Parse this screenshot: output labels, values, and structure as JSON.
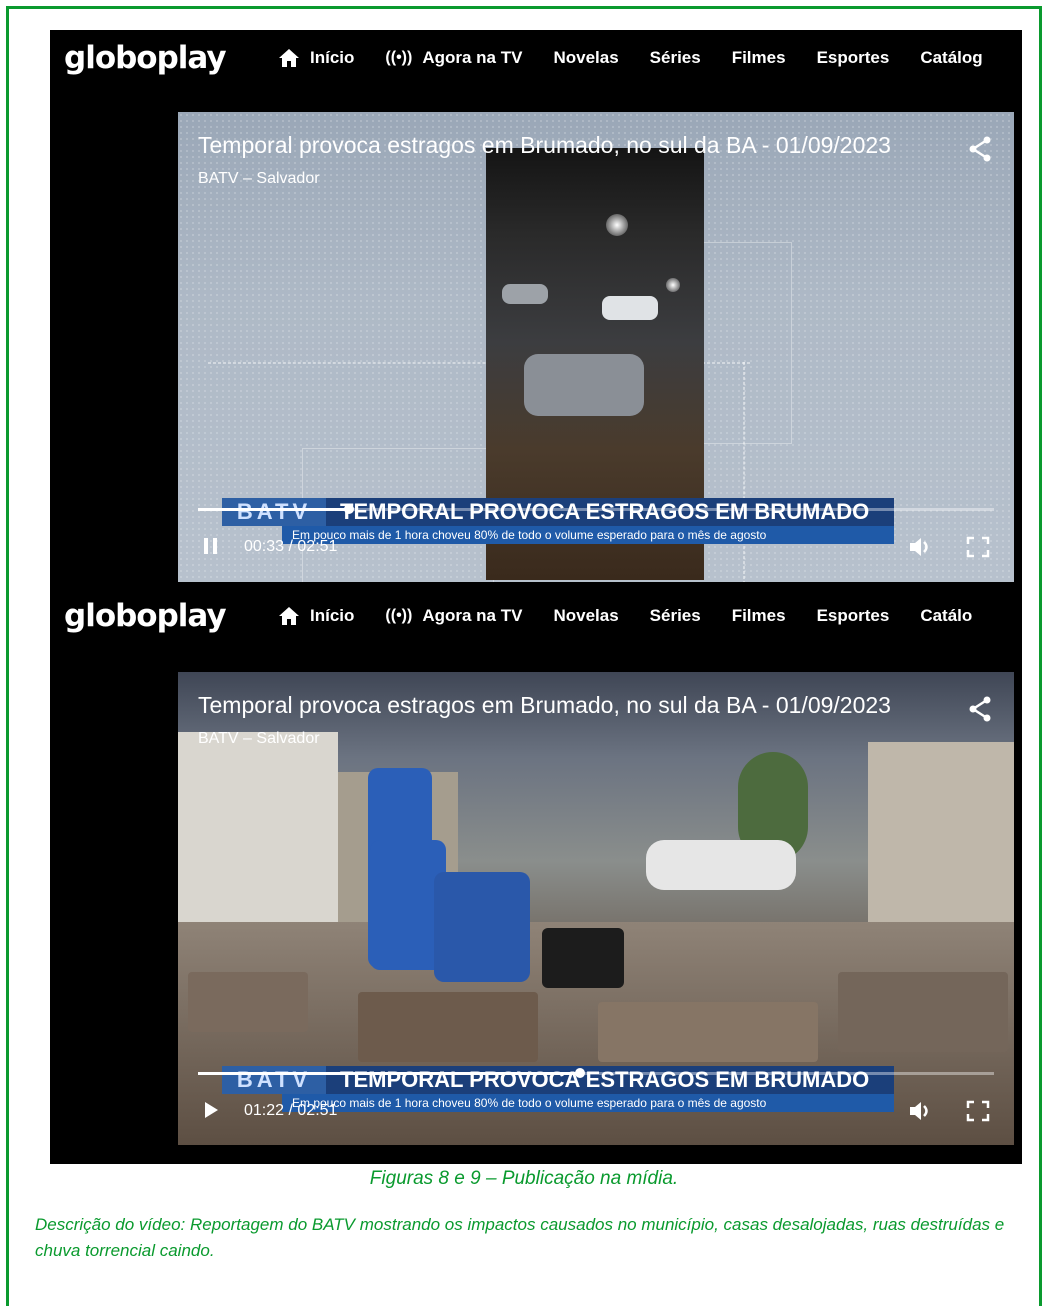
{
  "nav": {
    "logo": "globoplay",
    "items": [
      {
        "label": "Início",
        "icon": "home-icon"
      },
      {
        "label": "Agora na TV",
        "icon": "live-icon",
        "prefix": "((•))"
      },
      {
        "label": "Novelas"
      },
      {
        "label": "Séries"
      },
      {
        "label": "Filmes"
      },
      {
        "label": "Esportes"
      },
      {
        "label": "Catálog"
      }
    ],
    "items2_last": "Catálo"
  },
  "player1": {
    "title": "Temporal provoca estragos em Brumado, no sul da BA - 01/09/2023",
    "subtitle": "BATV – Salvador",
    "batv": "BATV",
    "headline": "TEMPORAL PROVOCA ESTRAGOS EM BRUMADO",
    "ticker": "Em pouco mais de 1 hora choveu 80% de todo o volume esperado para o mês de agosto",
    "current": "00:33",
    "duration": "02:51",
    "separator": "/",
    "progress": 0.19,
    "state": "playing"
  },
  "player2": {
    "title": "Temporal provoca estragos em Brumado, no sul da BA - 01/09/2023",
    "subtitle": "BATV – Salvador",
    "batv": "BATV",
    "headline": "TEMPORAL PROVOCA ESTRAGOS EM BRUMADO",
    "ticker": "Em pouco mais de 1 hora choveu 80% de todo o volume esperado para o mês de agosto",
    "current": "01:22",
    "duration": "02:51",
    "separator": "/",
    "progress": 0.48,
    "state": "paused"
  },
  "caption": "Figuras 8 e 9 – Publicação na mídia.",
  "description": "Descrição do vídeo: Reportagem do BATV mostrando os impactos causados no município, casas desalojadas, ruas destruídas e chuva torrencial caindo.",
  "colors": {
    "accent": "#0a9a2e",
    "batv_blue": "#1b3f7a"
  }
}
